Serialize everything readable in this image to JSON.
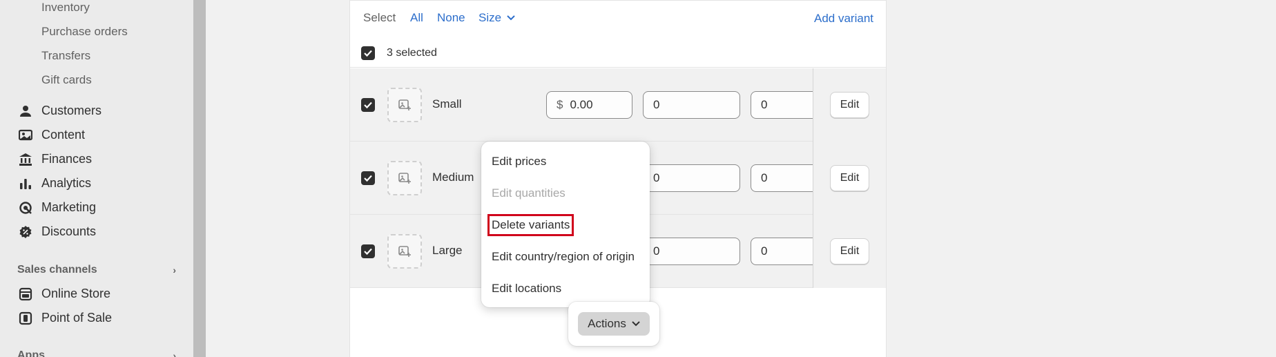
{
  "sidebar": {
    "sub_items": [
      "Inventory",
      "Purchase orders",
      "Transfers",
      "Gift cards"
    ],
    "nav_items": [
      {
        "label": "Customers",
        "icon": "person-icon"
      },
      {
        "label": "Content",
        "icon": "content-icon"
      },
      {
        "label": "Finances",
        "icon": "bank-icon"
      },
      {
        "label": "Analytics",
        "icon": "bar-chart-icon"
      },
      {
        "label": "Marketing",
        "icon": "target-icon"
      },
      {
        "label": "Discounts",
        "icon": "discount-icon"
      }
    ],
    "sales_channels_label": "Sales channels",
    "channels": [
      {
        "label": "Online Store",
        "icon": "store-icon"
      },
      {
        "label": "Point of Sale",
        "icon": "pos-icon"
      }
    ],
    "apps_label": "Apps"
  },
  "toolbar": {
    "select_label": "Select",
    "all_label": "All",
    "none_label": "None",
    "size_label": "Size",
    "add_variant_label": "Add variant"
  },
  "selection": {
    "label": "3 selected"
  },
  "variants": [
    {
      "name": "Small",
      "currency": "$",
      "price": "0.00",
      "qty1": "0",
      "qty2": "0",
      "edit_label": "Edit"
    },
    {
      "name": "Medium",
      "qty1": "0",
      "qty2": "0",
      "edit_label": "Edit"
    },
    {
      "name": "Large",
      "qty1": "0",
      "qty2": "0",
      "edit_label": "Edit"
    }
  ],
  "actions_menu": {
    "items": [
      {
        "label": "Edit prices",
        "disabled": false
      },
      {
        "label": "Edit quantities",
        "disabled": true
      },
      {
        "label": "Delete variants",
        "disabled": false,
        "highlighted": true
      },
      {
        "label": "Edit country/region of origin",
        "disabled": false
      },
      {
        "label": "Edit locations",
        "disabled": false
      }
    ]
  },
  "actions_button": {
    "label": "Actions"
  },
  "colors": {
    "link": "#2c6ecb",
    "highlight": "#d0021b",
    "checkbox": "#303030"
  }
}
